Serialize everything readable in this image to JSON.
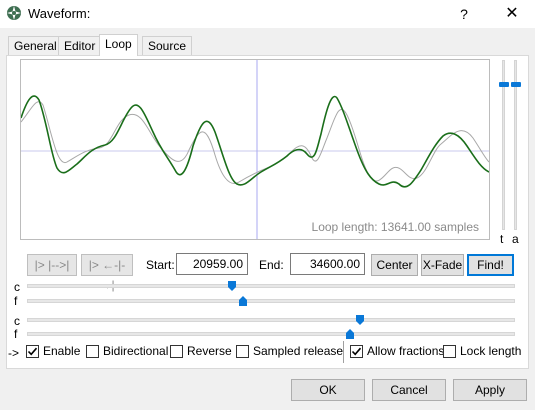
{
  "window": {
    "title": "Waveform:",
    "help": "?",
    "close": "✕"
  },
  "tabs": [
    "General",
    "Editor",
    "Loop",
    "Source"
  ],
  "waveform": {
    "loop_length": "Loop length: 13641.00 samples"
  },
  "vertical_sliders": {
    "t_label": "t",
    "a_label": "a",
    "t_value": 0.0,
    "a_value": 1.0
  },
  "controls": {
    "play_button": "|>  |-->|",
    "play_xfade_button": "|> ←-|-→|",
    "start_label": "Start:",
    "start_value": "20959.00",
    "end_label": "End:",
    "end_value": "34600.00",
    "center_button": "Center",
    "xfade_button": "X-Fade",
    "find_button": "Find!"
  },
  "sliders": {
    "c1_label": "c",
    "f1_label": "f",
    "c2_label": "c",
    "f2_label": "f",
    "c1_value": 0.42,
    "f1_value": 0.443,
    "c2_value": 0.683,
    "f2_value": 0.661
  },
  "options": {
    "arrow": "->",
    "enable": "Enable",
    "bidirectional": "Bidirectional",
    "reverse": "Reverse",
    "sampled_release": "Sampled release",
    "allow_fractions": "Allow fractions",
    "lock_length": "Lock length",
    "enable_checked": true,
    "bidirectional_checked": false,
    "reverse_checked": false,
    "sampled_release_checked": false,
    "allow_fractions_checked": true,
    "lock_length_checked": false
  },
  "buttons": {
    "ok": "OK",
    "cancel": "Cancel",
    "apply": "Apply"
  },
  "colors": {
    "accent": "#0a78d7",
    "wave": "#1a6e1a",
    "ghost": "#9a9a9a",
    "grid": "#b8b8e8"
  }
}
